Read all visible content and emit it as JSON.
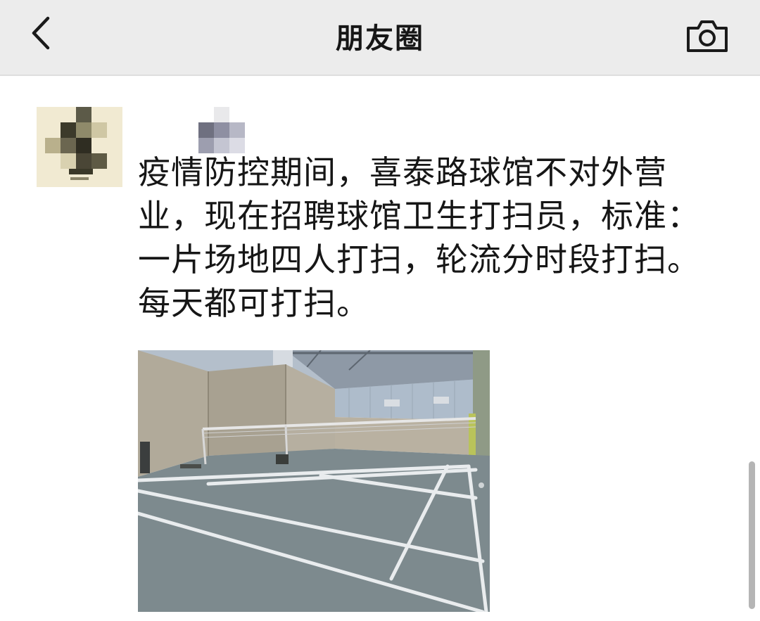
{
  "header": {
    "title": "朋友圈",
    "back_icon": "chevron-left-icon",
    "camera_icon": "camera-icon",
    "background_color": "#ececec"
  },
  "post": {
    "author_name": "",
    "text": "疫情防控期间，喜泰路球馆不对外营业，现在招聘球馆卫生打扫员，标准：一片场地四人打扫，轮流分时段打扫。每天都可打扫。",
    "image_subject": "indoor badminton court photo"
  }
}
